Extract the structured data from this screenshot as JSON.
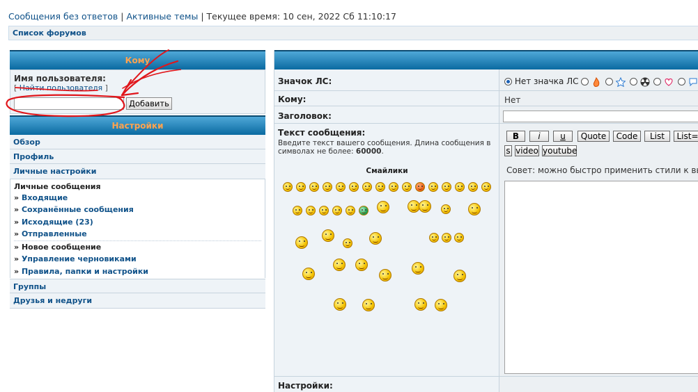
{
  "topnav": {
    "unanswered": "Сообщения без ответов",
    "sep1": "|",
    "active": "Активные темы",
    "sep2": "|",
    "time": "Текущее время: 10 сен, 2022 Сб 11:10:17"
  },
  "breadcrumb": "Список форумов",
  "left": {
    "to_header": "Кому",
    "username_label": "Имя пользователя:",
    "find_user_open": "[",
    "find_user": "Найти пользователя",
    "find_user_close": "]",
    "username_value": "",
    "add_button": "Добавить",
    "settings_header": "Настройки",
    "nav": [
      "Обзор",
      "Профиль",
      "Личные настройки"
    ],
    "pm_title": "Личные сообщения",
    "pm_arrow": "»",
    "pm_items": [
      "Входящие",
      "Сохранённые сообщения",
      "Исходящие (23)",
      "Отправленные"
    ],
    "pm_items2": [
      "Новое сообщение",
      "Управление черновиками",
      "Правила, папки и настройки"
    ],
    "groups": "Группы",
    "friends": "Друзья и недруги"
  },
  "right": {
    "pm_icon_label": "Значок ЛС:",
    "no_icon": "Нет значка ЛС",
    "to_label": "Кому:",
    "to_value": "Нет",
    "subject_label": "Заголовок:",
    "subject_value": "",
    "message_label": "Текст сообщения:",
    "message_desc_prefix": "Введите текст вашего сообщения. Длина сообщения в символах не более:",
    "message_max": "60000",
    "message_desc_suffix": ".",
    "smileys_title": "Смайлики",
    "format_buttons": [
      "B",
      "i",
      "u",
      "Quote",
      "Code",
      "List",
      "List="
    ],
    "format_buttons2": [
      "s",
      "video",
      "youtube"
    ],
    "tip": "Совет: можно быстро применить стили к выдел",
    "message_value": "",
    "settings_label": "Настройки:"
  },
  "colors": {
    "header_blue": "#0a6aa1",
    "header_text": "#ffa34f",
    "link": "#105289",
    "row_bg": "#eef3f7",
    "annotation_red": "#e0161b"
  },
  "icons": [
    "fire-icon",
    "star-icon",
    "radiation-icon",
    "heart-icon",
    "speech-bubble-icon"
  ]
}
